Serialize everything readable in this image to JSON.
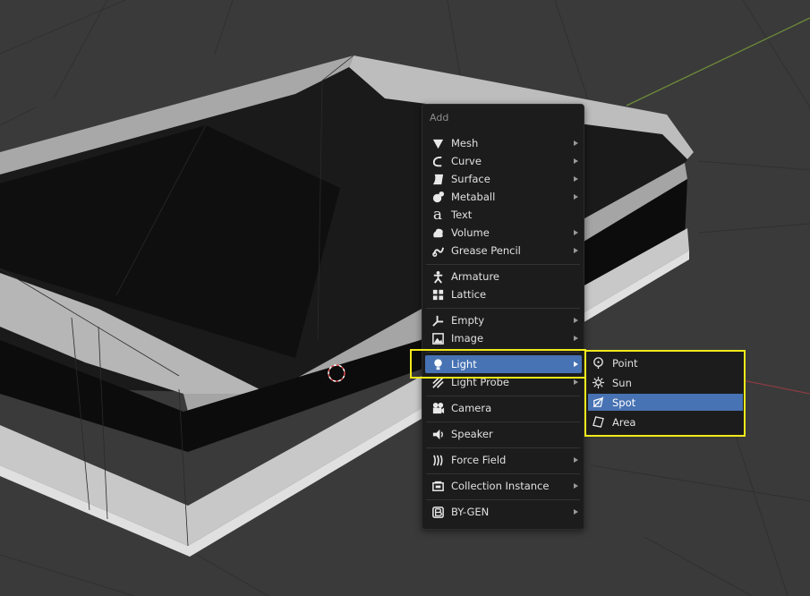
{
  "menu": {
    "title": "Add",
    "items": [
      {
        "label": "Mesh",
        "icon": "mesh-icon",
        "submenu": true
      },
      {
        "label": "Curve",
        "icon": "curve-icon",
        "submenu": true
      },
      {
        "label": "Surface",
        "icon": "surface-icon",
        "submenu": true
      },
      {
        "label": "Metaball",
        "icon": "metaball-icon",
        "submenu": true
      },
      {
        "label": "Text",
        "icon": "text-icon",
        "submenu": false
      },
      {
        "label": "Volume",
        "icon": "volume-icon",
        "submenu": true
      },
      {
        "label": "Grease Pencil",
        "icon": "grease-pencil-icon",
        "submenu": true
      },
      {
        "label": "Armature",
        "icon": "armature-icon",
        "submenu": false
      },
      {
        "label": "Lattice",
        "icon": "lattice-icon",
        "submenu": false
      },
      {
        "label": "Empty",
        "icon": "empty-icon",
        "submenu": true
      },
      {
        "label": "Image",
        "icon": "image-icon",
        "submenu": true
      },
      {
        "label": "Light",
        "icon": "light-icon",
        "submenu": true,
        "active": true
      },
      {
        "label": "Light Probe",
        "icon": "light-probe-icon",
        "submenu": true
      },
      {
        "label": "Camera",
        "icon": "camera-icon",
        "submenu": false
      },
      {
        "label": "Speaker",
        "icon": "speaker-icon",
        "submenu": false
      },
      {
        "label": "Force Field",
        "icon": "force-field-icon",
        "submenu": true
      },
      {
        "label": "Collection Instance",
        "icon": "collection-instance-icon",
        "submenu": true
      },
      {
        "label": "BY-GEN",
        "icon": "by-gen-icon",
        "submenu": true
      }
    ]
  },
  "light_submenu": {
    "items": [
      {
        "label": "Point",
        "icon": "point-light-icon"
      },
      {
        "label": "Sun",
        "icon": "sun-light-icon"
      },
      {
        "label": "Spot",
        "icon": "spot-light-icon",
        "active": true
      },
      {
        "label": "Area",
        "icon": "area-light-icon"
      }
    ]
  },
  "colors": {
    "menu_bg": "#1c1c1c",
    "highlight": "#4772b3",
    "annotation_box": "#f2ea1a",
    "viewport_bg": "#3a3a3a"
  }
}
